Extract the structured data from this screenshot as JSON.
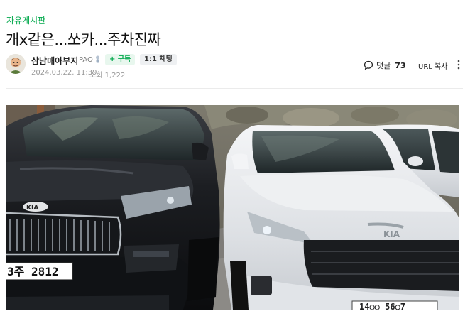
{
  "board": {
    "name": "자유게시판"
  },
  "post": {
    "title": "개x같은...쏘카...주차진짜",
    "date": "2024.03.22. 11:39",
    "views": "조회 1,222",
    "photo": {
      "left_plate": "3주 2812",
      "right_plate": "14○○ 56○7",
      "left_badge": "KIA",
      "right_badge": "KIA"
    }
  },
  "author": {
    "name": "삼남매아부지",
    "level": "PAO",
    "subscribe_label": "+ 구독",
    "chat_label": "1:1 채팅",
    "avatar_icon": "avatar-face"
  },
  "actions": {
    "comment_label": "댓글",
    "comment_count": "73",
    "url_copy_label": "URL 복사"
  },
  "colors": {
    "accent": "#03a94d",
    "subscribe_bg": "#e8f7ee",
    "meta_text": "#999999"
  }
}
